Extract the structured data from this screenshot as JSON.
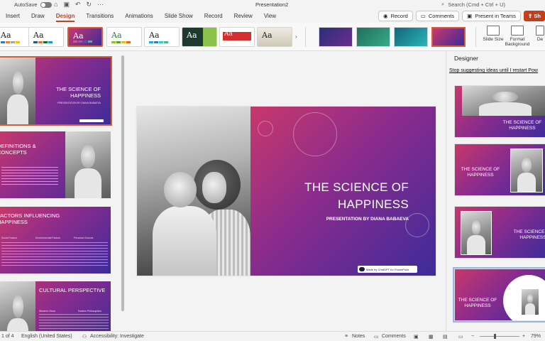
{
  "titlebar": {
    "autosave_label": "AutoSave",
    "doc_title": "Presentation2",
    "search_placeholder": "Search (Cmd + Ctrl + U)"
  },
  "tabs": [
    "Insert",
    "Draw",
    "Design",
    "Transitions",
    "Animations",
    "Slide Show",
    "Record",
    "Review",
    "View"
  ],
  "active_tab": "Design",
  "actions": {
    "record": "Record",
    "comments": "Comments",
    "present_in_teams": "Present in Teams",
    "share": "Sh"
  },
  "ribbon": {
    "theme_label": "Aa",
    "slide_size": "Slide Size",
    "format_background": "Format Background",
    "designer_short": "De"
  },
  "slides": [
    {
      "num": 1,
      "title": "THE SCIENCE OF HAPPINESS",
      "subtitle": "PRESENTATION BY DIANA BABAEVA"
    },
    {
      "num": 2,
      "title": "DEFINITIONS & CONCEPTS"
    },
    {
      "num": 3,
      "title": "FACTORS INFLUENCING HAPPINESS",
      "columns": [
        "Social Factors",
        "Environmental Factors",
        "Personal Choices"
      ]
    },
    {
      "num": 4,
      "title": "CULTURAL PERSPECTIVE",
      "columns": [
        "Western Views",
        "Eastern Philosophies"
      ]
    }
  ],
  "main_slide": {
    "title_line1": "THE SCIENCE OF",
    "title_line2": "HAPPINESS",
    "subtitle": "PRESENTATION BY DIANA BABAEVA",
    "badge": "Made by ChatGPT for PowerPoint"
  },
  "designer": {
    "header": "Designer",
    "stop_link": "Stop suggesting ideas until I restart Pow",
    "ideas": [
      {
        "title": "THE SCIENCE OF HAPPINESS"
      },
      {
        "title": "THE SCIENCE OF HAPPINESS"
      },
      {
        "title": "THE SCIENCE OF HAPPINESS"
      },
      {
        "title": "THE SCIENCE OF HAPPINESS"
      }
    ]
  },
  "statusbar": {
    "slide_count": "1 of 4",
    "language": "English (United States)",
    "accessibility": "Accessibility: Investigate",
    "notes": "Notes",
    "comments": "Comments",
    "zoom": "79%"
  },
  "colors": {
    "accent": "#b7472a",
    "slide_pink": "#c8386b",
    "slide_purple": "#8a2b8d",
    "slide_indigo": "#3d2b9a"
  }
}
